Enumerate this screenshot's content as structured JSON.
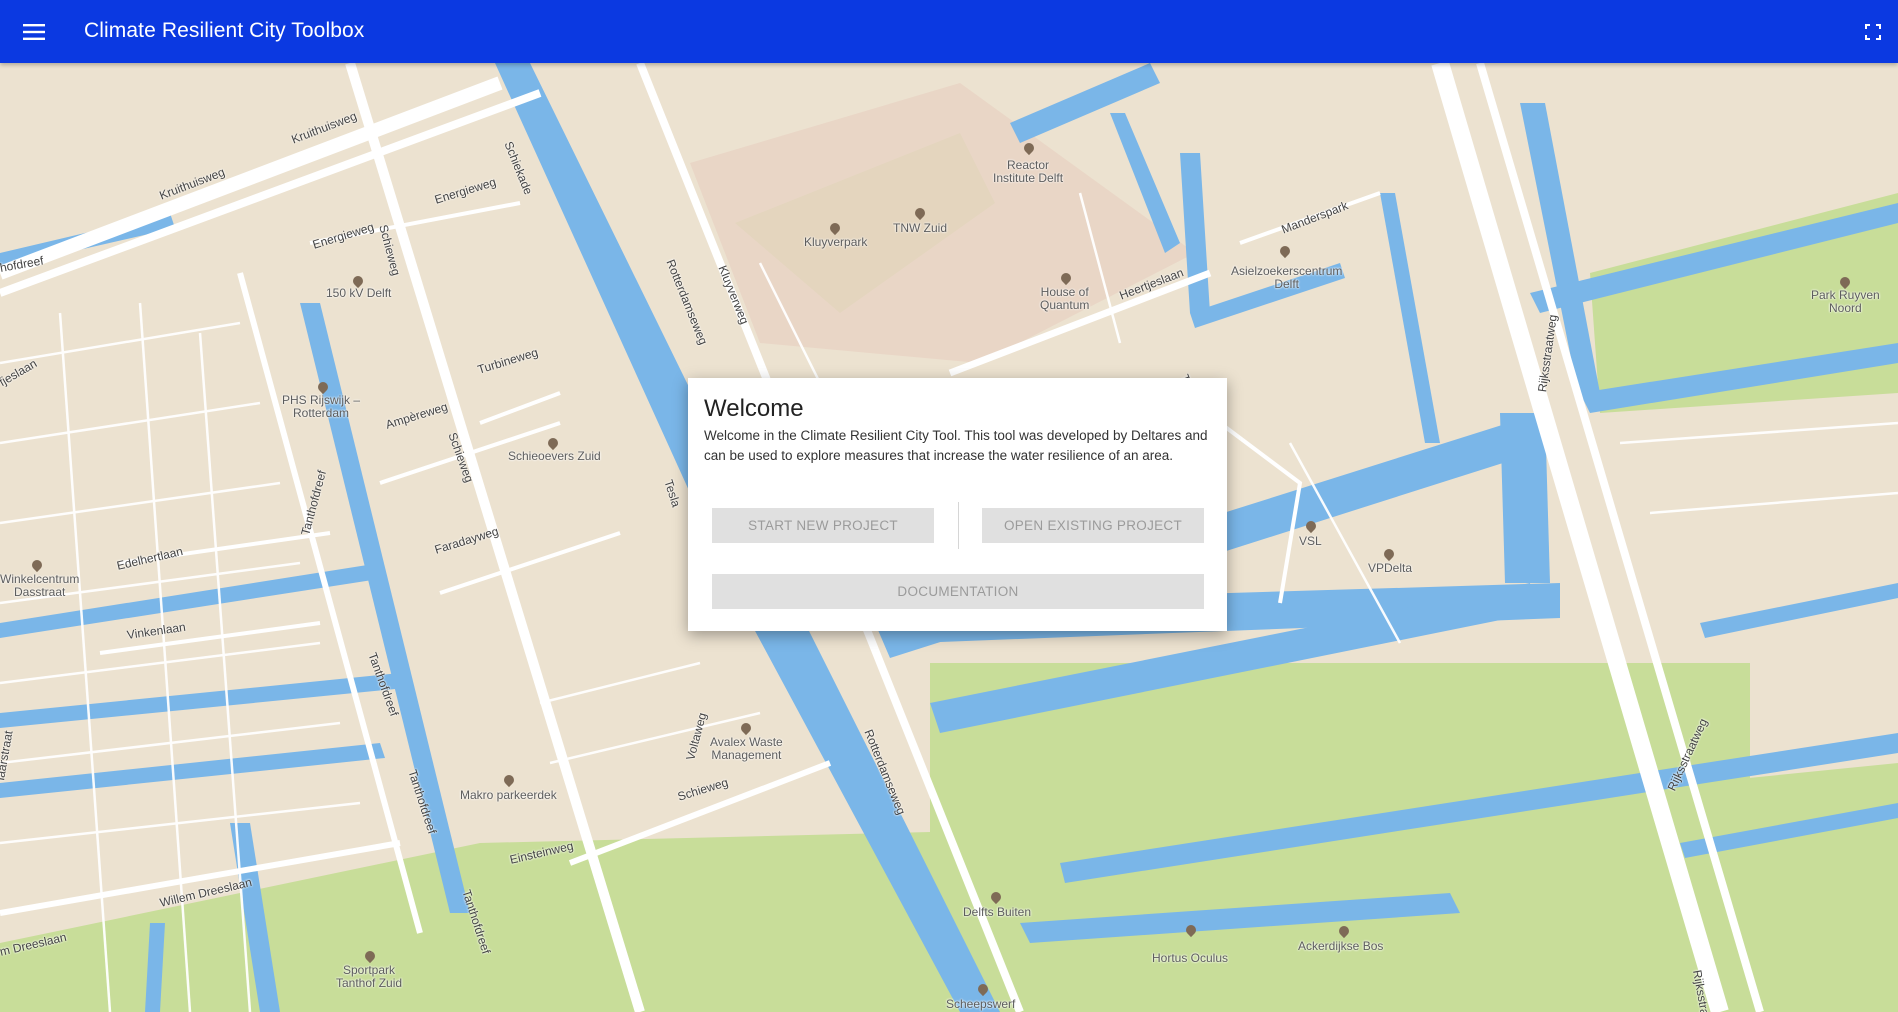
{
  "header": {
    "title": "Climate Resilient City Toolbox",
    "menu_icon": "menu-icon",
    "fullscreen_icon": "fullscreen-icon",
    "background": "#0b39e1"
  },
  "dialog": {
    "title": "Welcome",
    "body": "Welcome in the Climate Resilient City Tool. This tool was developed by Deltares and can be used to explore measures that increase the water resilience of an area.",
    "start_label": "START NEW PROJECT",
    "open_label": "OPEN EXISTING PROJECT",
    "docs_label": "DOCUMENTATION"
  },
  "map": {
    "pois": [
      {
        "id": "reactor",
        "label": "Reactor\nInstitute Delft"
      },
      {
        "id": "tnw",
        "label": "TNW Zuid"
      },
      {
        "id": "kluyverpark",
        "label": "Kluyverpark"
      },
      {
        "id": "quantum",
        "label": "House of\nQuantum"
      },
      {
        "id": "asielzoekers",
        "label": "Asielzoekerscentrum\nDelft"
      },
      {
        "id": "ruyven",
        "label": "Park Ruyven\nNoord"
      },
      {
        "id": "kv",
        "label": "150 kV Delft"
      },
      {
        "id": "phs",
        "label": "PHS Rijswijk –\nRotterdam"
      },
      {
        "id": "schieoevers",
        "label": "Schieoevers Zuid"
      },
      {
        "id": "winkelcentrum",
        "label": "Winkelcentrum\nDasstraat"
      },
      {
        "id": "vsl",
        "label": "VSL"
      },
      {
        "id": "vpdelta",
        "label": "VPDelta"
      },
      {
        "id": "avalex",
        "label": "Avalex Waste\nManagement"
      },
      {
        "id": "makro",
        "label": "Makro parkeerdek"
      },
      {
        "id": "delfts",
        "label": "Delfts Buiten"
      },
      {
        "id": "hortus",
        "label": "Hortus Oculus"
      },
      {
        "id": "ackerdijkse",
        "label": "Ackerdijkse Bos"
      },
      {
        "id": "sportpark",
        "label": "Sportpark\nTanthof Zuid"
      },
      {
        "id": "scheepswerf",
        "label": "Scheepswerf"
      }
    ],
    "roads": [
      {
        "id": "kruithuisweg1",
        "label": "Kruithuisweg"
      },
      {
        "id": "kruithuisweg2",
        "label": "Kruithuisweg"
      },
      {
        "id": "schiekade",
        "label": "Schiekade"
      },
      {
        "id": "energieweg1",
        "label": "Energieweg"
      },
      {
        "id": "energieweg2",
        "label": "Energieweg"
      },
      {
        "id": "schieweg1",
        "label": "Schieweg"
      },
      {
        "id": "schieweg2",
        "label": "Schieweg"
      },
      {
        "id": "schieweg3",
        "label": "Schieweg"
      },
      {
        "id": "rotterdamseweg1",
        "label": "Rotterdamseweg"
      },
      {
        "id": "rotterdamseweg2",
        "label": "Rotterdamseweg"
      },
      {
        "id": "kluyverweg",
        "label": "Kluyverweg"
      },
      {
        "id": "heertjeslaan",
        "label": "Heertjeslaan"
      },
      {
        "id": "manderspark",
        "label": "Manderspark"
      },
      {
        "id": "rijksstraatweg1",
        "label": "Rijksstraatweg"
      },
      {
        "id": "rijksstraatweg2",
        "label": "Rijksstraatweg"
      },
      {
        "id": "rijksstraatweg3",
        "label": "Rijksstraatweg"
      },
      {
        "id": "turbineweg",
        "label": "Turbineweg"
      },
      {
        "id": "ampereweg",
        "label": "Ampèreweg"
      },
      {
        "id": "faradayweg",
        "label": "Faradayweg"
      },
      {
        "id": "voltaweg",
        "label": "Voltaweg"
      },
      {
        "id": "einsteinweg",
        "label": "Einsteinweg"
      },
      {
        "id": "tanthofdreef1",
        "label": "Tanthofdreef"
      },
      {
        "id": "tanthofdreef2",
        "label": "Tanthofdreef"
      },
      {
        "id": "tanthofdreef3",
        "label": "Tanthofdreef"
      },
      {
        "id": "tanthofdreef4",
        "label": "Tanthofdreef"
      },
      {
        "id": "edelhertlaan",
        "label": "Edelhertlaan"
      },
      {
        "id": "vinkenlaan",
        "label": "Vinkenlaan"
      },
      {
        "id": "willemdreeslaan1",
        "label": "Willem Dreeslaan"
      },
      {
        "id": "willemdreeslaan2",
        "label": "m Dreeslaan"
      },
      {
        "id": "hofdreef",
        "label": "hofdreef"
      },
      {
        "id": "fjeslaan",
        "label": "fjeslaan"
      },
      {
        "id": "tesla",
        "label": "Tesla"
      },
      {
        "id": "laarstraat",
        "label": "laarstraat"
      },
      {
        "id": "th",
        "label": "Th"
      }
    ]
  },
  "colors": {
    "land": "#ece2d0",
    "water": "#7ab6e8",
    "park": "#c8dd99",
    "campus": "#e9d4c4",
    "road": "#ffffff"
  }
}
